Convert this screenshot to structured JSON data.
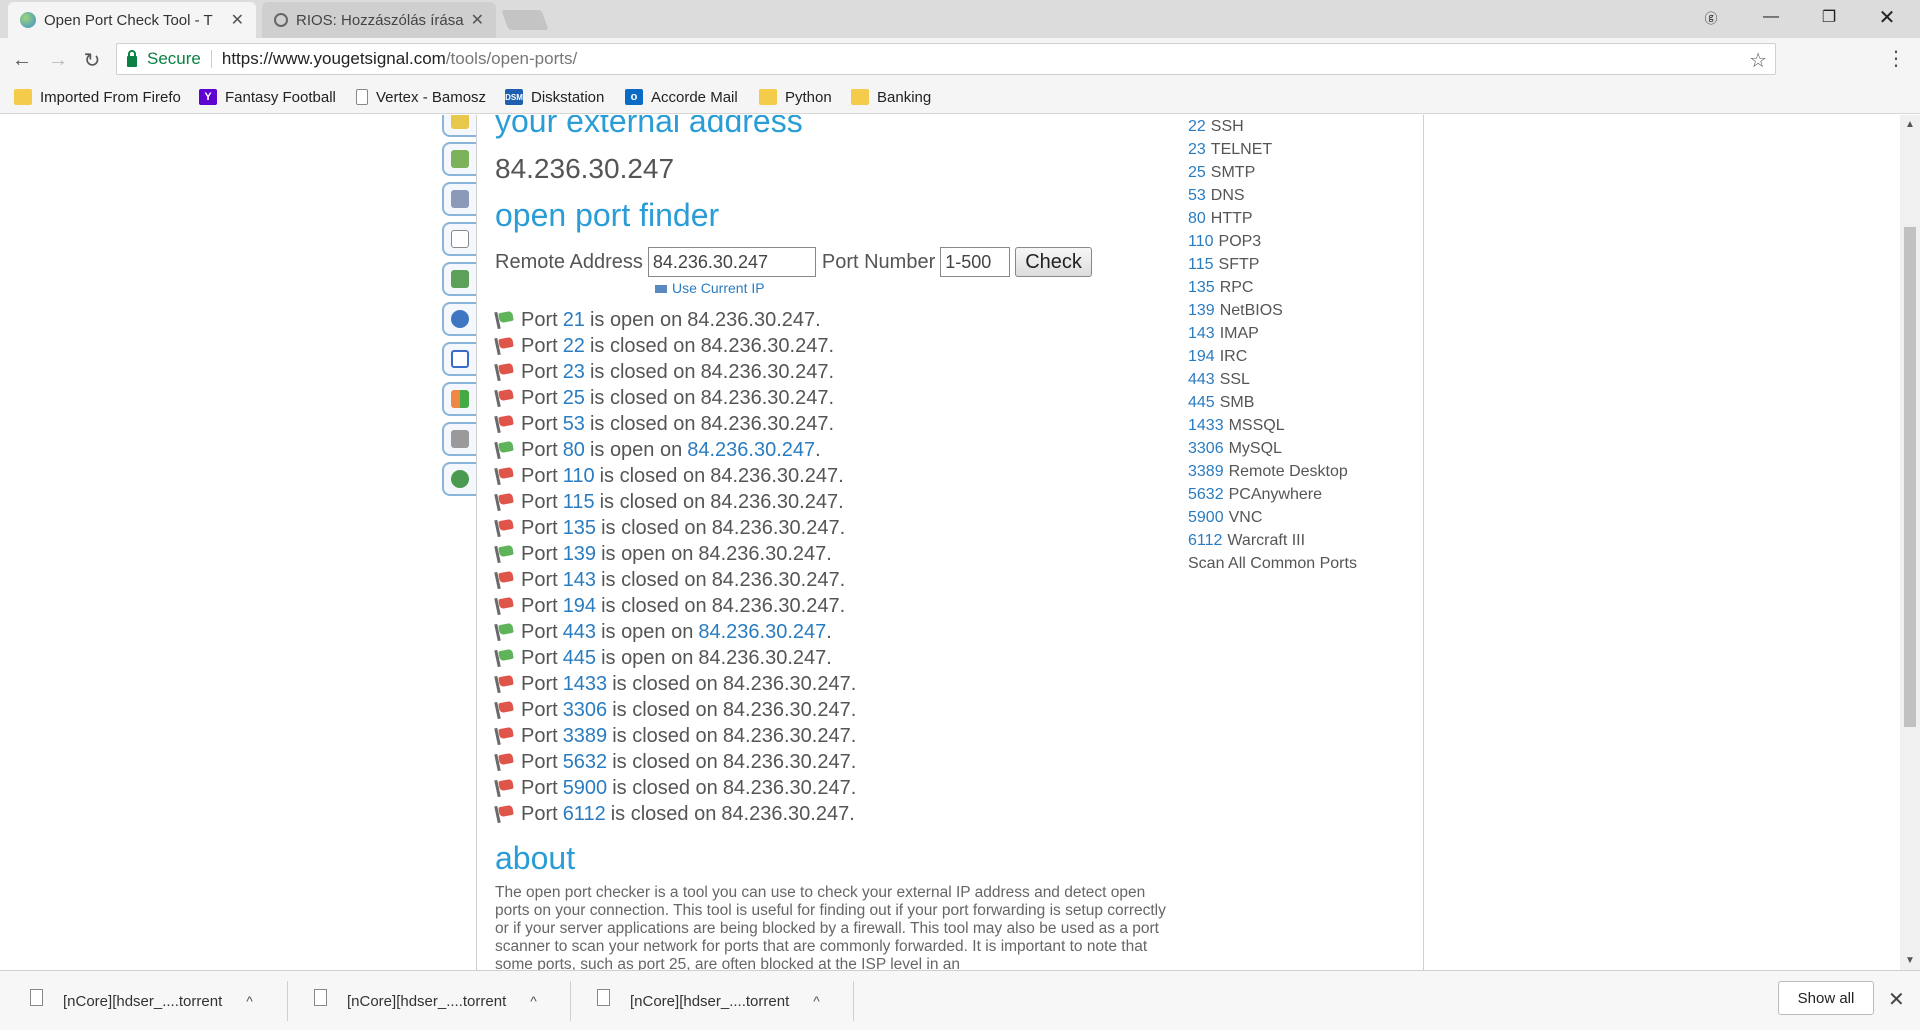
{
  "browser": {
    "tabs": [
      {
        "title": "Open Port Check Tool - T",
        "active": true
      },
      {
        "title": "RIOS: Hozzászólás írása -",
        "active": false
      }
    ],
    "secure_label": "Secure",
    "url_host": "https://www.yougetsignal.com",
    "url_path": "/tools/open-ports/",
    "bookmarks": [
      {
        "label": "Imported From Firefo",
        "icon": "folder-icon"
      },
      {
        "label": "Fantasy Football",
        "icon": "yahoo-icon"
      },
      {
        "label": "Vertex - Bamosz",
        "icon": "page-icon"
      },
      {
        "label": "Diskstation",
        "icon": "dsm-icon"
      },
      {
        "label": "Accorde Mail",
        "icon": "outlook-icon"
      },
      {
        "label": "Python",
        "icon": "folder-icon"
      },
      {
        "label": "Banking",
        "icon": "folder-icon"
      }
    ]
  },
  "page": {
    "ext_heading": "your external address",
    "ip": "84.236.30.247",
    "finder_heading": "open port finder",
    "remote_label": "Remote Address",
    "remote_value": "84.236.30.247",
    "port_label": "Port Number",
    "port_value": "1-500",
    "check_label": "Check",
    "use_current": "Use Current IP",
    "word_port": "Port",
    "results": [
      {
        "port": "21",
        "text": "is open on",
        "host": "84.236.30.247.",
        "status": "open",
        "link": false
      },
      {
        "port": "22",
        "text": "is closed on",
        "host": "84.236.30.247.",
        "status": "closed",
        "link": false
      },
      {
        "port": "23",
        "text": "is closed on",
        "host": "84.236.30.247.",
        "status": "closed",
        "link": false
      },
      {
        "port": "25",
        "text": "is closed on",
        "host": "84.236.30.247.",
        "status": "closed",
        "link": false
      },
      {
        "port": "53",
        "text": "is closed on",
        "host": "84.236.30.247.",
        "status": "closed",
        "link": false
      },
      {
        "port": "80",
        "text": "is open on",
        "host": "84.236.30.247",
        "status": "open",
        "link": true
      },
      {
        "port": "110",
        "text": "is closed on",
        "host": "84.236.30.247.",
        "status": "closed",
        "link": false
      },
      {
        "port": "115",
        "text": "is closed on",
        "host": "84.236.30.247.",
        "status": "closed",
        "link": false
      },
      {
        "port": "135",
        "text": "is closed on",
        "host": "84.236.30.247.",
        "status": "closed",
        "link": false
      },
      {
        "port": "139",
        "text": "is open on",
        "host": "84.236.30.247.",
        "status": "open",
        "link": false
      },
      {
        "port": "143",
        "text": "is closed on",
        "host": "84.236.30.247.",
        "status": "closed",
        "link": false
      },
      {
        "port": "194",
        "text": "is closed on",
        "host": "84.236.30.247.",
        "status": "closed",
        "link": false
      },
      {
        "port": "443",
        "text": "is open on",
        "host": "84.236.30.247",
        "status": "open",
        "link": true
      },
      {
        "port": "445",
        "text": "is open on",
        "host": "84.236.30.247.",
        "status": "open",
        "link": false
      },
      {
        "port": "1433",
        "text": "is closed on",
        "host": "84.236.30.247.",
        "status": "closed",
        "link": false
      },
      {
        "port": "3306",
        "text": "is closed on",
        "host": "84.236.30.247.",
        "status": "closed",
        "link": false
      },
      {
        "port": "3389",
        "text": "is closed on",
        "host": "84.236.30.247.",
        "status": "closed",
        "link": false
      },
      {
        "port": "5632",
        "text": "is closed on",
        "host": "84.236.30.247.",
        "status": "closed",
        "link": false
      },
      {
        "port": "5900",
        "text": "is closed on",
        "host": "84.236.30.247.",
        "status": "closed",
        "link": false
      },
      {
        "port": "6112",
        "text": "is closed on",
        "host": "84.236.30.247.",
        "status": "closed",
        "link": false
      }
    ],
    "about_heading": "about",
    "about_text": "The open port checker is a tool you can use to check your external IP address and detect open ports on your connection. This tool is useful for finding out if your port forwarding is setup correctly or if your server applications are being blocked by a firewall. This tool may also be used as a port scanner to scan your network for ports that are commonly forwarded. It is important to note that some ports, such as port 25, are often blocked at the ISP level in an",
    "common_ports": [
      {
        "port": "22",
        "name": "SSH"
      },
      {
        "port": "23",
        "name": "TELNET"
      },
      {
        "port": "25",
        "name": "SMTP"
      },
      {
        "port": "53",
        "name": "DNS"
      },
      {
        "port": "80",
        "name": "HTTP"
      },
      {
        "port": "110",
        "name": "POP3"
      },
      {
        "port": "115",
        "name": "SFTP"
      },
      {
        "port": "135",
        "name": "RPC"
      },
      {
        "port": "139",
        "name": "NetBIOS"
      },
      {
        "port": "143",
        "name": "IMAP"
      },
      {
        "port": "194",
        "name": "IRC"
      },
      {
        "port": "443",
        "name": "SSL"
      },
      {
        "port": "445",
        "name": "SMB"
      },
      {
        "port": "1433",
        "name": "MSSQL"
      },
      {
        "port": "3306",
        "name": "MySQL"
      },
      {
        "port": "3389",
        "name": "Remote Desktop"
      },
      {
        "port": "5632",
        "name": "PCAnywhere"
      },
      {
        "port": "5900",
        "name": "VNC"
      },
      {
        "port": "6112",
        "name": "Warcraft III"
      }
    ],
    "scan_all": "Scan All Common Ports"
  },
  "downloads": {
    "items": [
      "[nCore][hdser_....torrent",
      "[nCore][hdser_....torrent",
      "[nCore][hdser_....torrent"
    ],
    "show_all": "Show all"
  },
  "colors": {
    "accent": "#2a9cd6",
    "link": "#2a7cc0",
    "open_flag": "#5fb35a",
    "closed_flag": "#e0554a"
  }
}
